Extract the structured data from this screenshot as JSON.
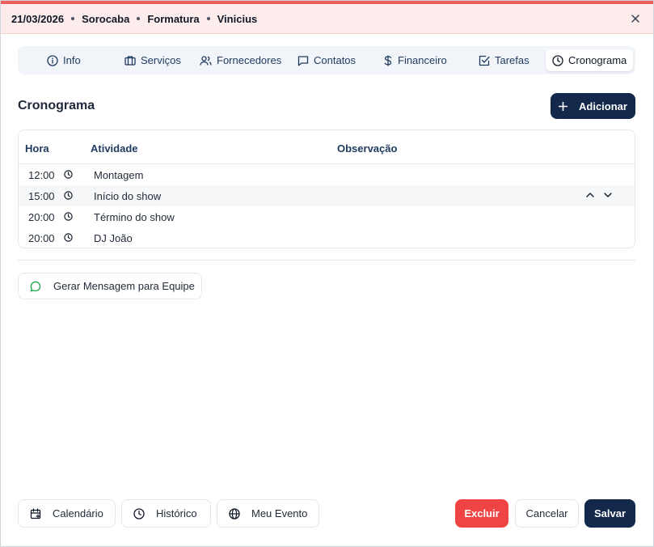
{
  "header": {
    "date": "21/03/2026",
    "city": "Sorocaba",
    "type": "Formatura",
    "client": "Vinicius",
    "accent": "#f05d5d"
  },
  "tabs": [
    {
      "label": "Info",
      "icon": "info-icon"
    },
    {
      "label": "Serviços",
      "icon": "briefcase-icon"
    },
    {
      "label": "Fornecedores",
      "icon": "users-icon"
    },
    {
      "label": "Contatos",
      "icon": "message-square-icon"
    },
    {
      "label": "Financeiro",
      "icon": "dollar-icon"
    },
    {
      "label": "Tarefas",
      "icon": "check-square-icon"
    },
    {
      "label": "Cronograma",
      "icon": "clock-icon",
      "active": true
    }
  ],
  "section": {
    "title": "Cronograma",
    "add_label": "Adicionar"
  },
  "table": {
    "columns": [
      "Hora",
      "Atividade",
      "Observação"
    ],
    "rows": [
      {
        "time": "12:00",
        "activity": "Montagem",
        "note": ""
      },
      {
        "time": "15:00",
        "activity": "Início do show",
        "note": ""
      },
      {
        "time": "20:00",
        "activity": "Término do show",
        "note": ""
      },
      {
        "time": "20:00",
        "activity": "DJ João",
        "note": ""
      }
    ]
  },
  "message_button": "Gerar Mensagem para Equipe",
  "footer": {
    "calendar": "Calendário",
    "history": "Histórico",
    "my_event": "Meu Evento",
    "delete": "Excluir",
    "cancel": "Cancelar",
    "save": "Salvar"
  },
  "colors": {
    "primary": "#13294b",
    "danger": "#ef4444",
    "header_bg": "#fdecec"
  }
}
